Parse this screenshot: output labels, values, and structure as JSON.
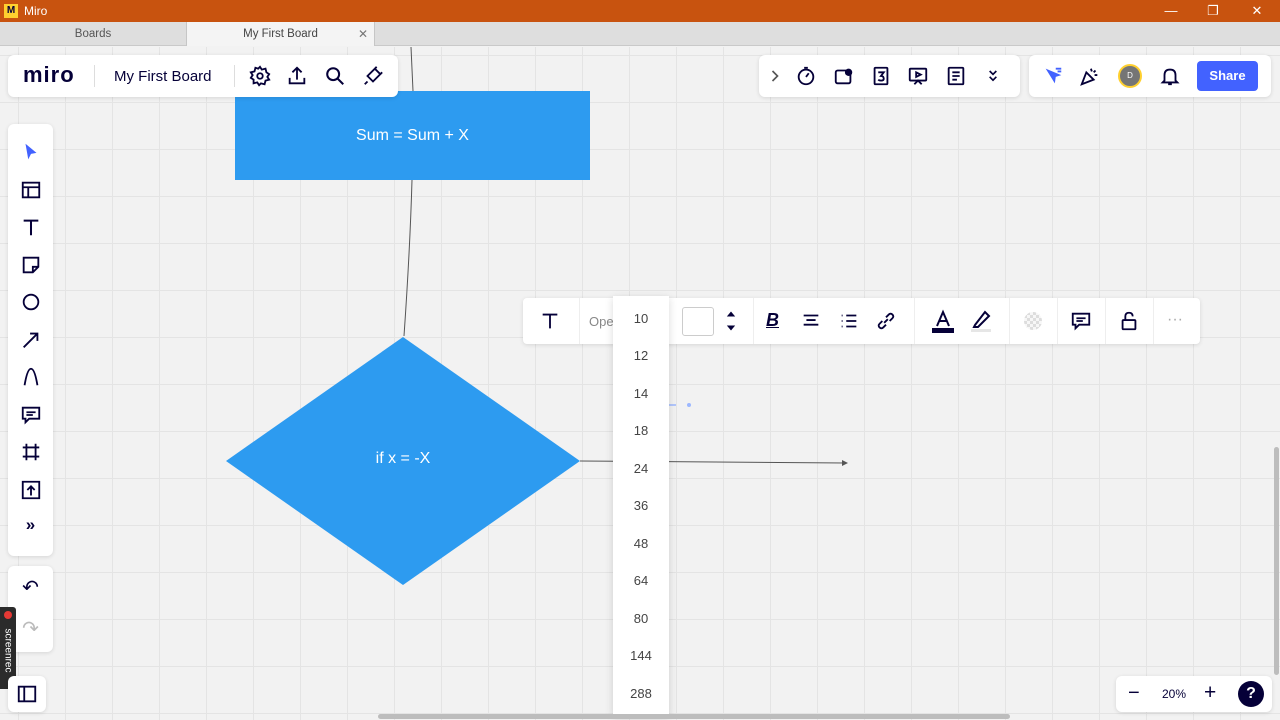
{
  "window": {
    "title": "Miro",
    "minimize_glyph": "—",
    "restore_glyph": "❐",
    "close_glyph": "✕"
  },
  "tabs": [
    {
      "label": "Boards",
      "active": false
    },
    {
      "label": "My First Board",
      "active": true,
      "close_glyph": "✕"
    }
  ],
  "header": {
    "logo": "miro",
    "board_name": "My First Board",
    "icons": [
      "settings-icon",
      "export-icon",
      "search-icon",
      "plugin-icon"
    ]
  },
  "top_right_tools": {
    "icons": [
      "chevron-right-icon",
      "timer-icon",
      "voting-icon",
      "counter-icon",
      "presentation-icon",
      "notes-icon",
      "more-tools-icon"
    ]
  },
  "collab": {
    "icons": [
      "cursor-filter-icon",
      "celebrate-icon",
      "bell-icon"
    ],
    "avatar_initial": "D",
    "share_label": "Share"
  },
  "left_toolbar": {
    "tools": [
      "select-icon",
      "templates-icon",
      "text-icon",
      "sticky-note-icon",
      "shape-icon",
      "arrow-icon",
      "pen-icon",
      "comment-icon",
      "frame-icon",
      "upload-icon",
      "more-icon"
    ],
    "more_glyph": "»",
    "undo_glyph": "↶",
    "redo_glyph": "↷"
  },
  "recorder_label": "screenrec",
  "shapes": {
    "rect_text": "Sum = Sum + X",
    "diamond_text": "if x = -X"
  },
  "text_toolbar": {
    "font_label": "Ope",
    "size_value": "",
    "bold_label": "B",
    "more_label": "···"
  },
  "font_size_options": [
    "10",
    "12",
    "14",
    "18",
    "24",
    "36",
    "48",
    "64",
    "80",
    "144",
    "288"
  ],
  "zoom": {
    "level": "20%",
    "minus": "−",
    "plus": "+",
    "help": "?"
  },
  "colors": {
    "accent": "#4262ff",
    "shape": "#2d9bf0",
    "titlebar": "#c8530f"
  }
}
